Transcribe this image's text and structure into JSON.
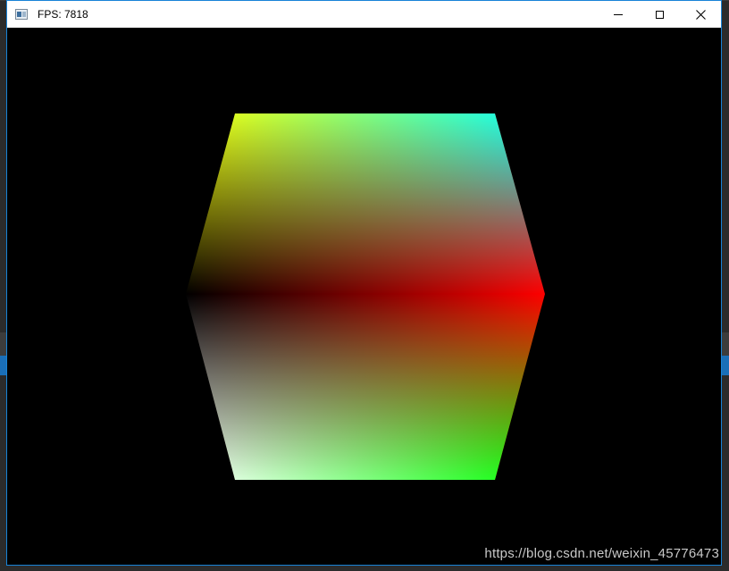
{
  "window": {
    "title": "FPS: 7818",
    "icon": "app-window-icon",
    "controls": {
      "minimize_icon": "minimize-icon",
      "maximize_icon": "maximize-icon",
      "close_icon": "close-icon"
    },
    "border_color": "#1883d7"
  },
  "scene": {
    "background": "#000000",
    "object": "color-gradient-cube",
    "vertex_colors": {
      "top_left": "#ffff00",
      "top_right": "#00ffff",
      "mid_left": "#000000",
      "mid_right": "#ff0000",
      "bottom_left": "#ffffff",
      "bottom_right": "#00ff00"
    }
  },
  "watermark": "https://blog.csdn.net/weixin_45776473"
}
